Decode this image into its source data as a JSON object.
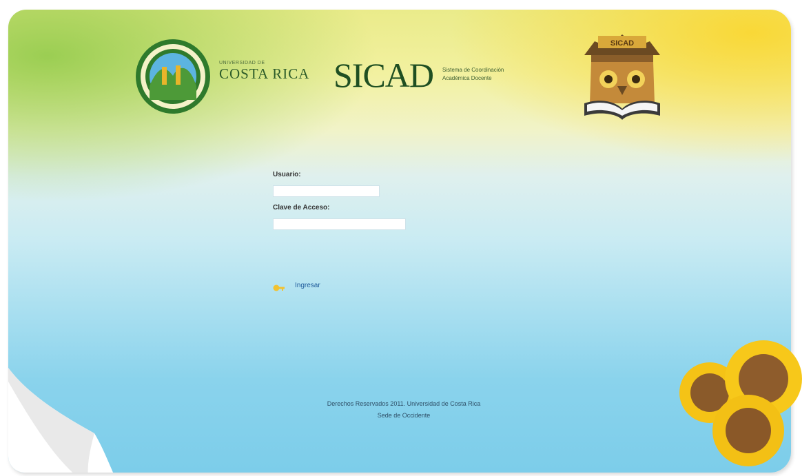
{
  "header": {
    "ucr_top_text": "UNIVERSIDAD DE",
    "ucr_name": "COSTA RICA",
    "system_name": "SICAD",
    "system_subtitle_line1": "Sistema de Coordinación",
    "system_subtitle_line2": "Académica Docente",
    "emblem_label": "SICAD"
  },
  "login": {
    "user_label": "Usuario:",
    "user_value": "",
    "password_label": "Clave de Acceso:",
    "password_value": "",
    "login_link": "Ingresar",
    "login_icon": "key-icon"
  },
  "footer": {
    "line1": "Derechos Reservados 2011. Universidad de Costa Rica",
    "line2": "Sede de Occidente"
  },
  "colors": {
    "top_left": "#8cc846",
    "top_right": "#fad732",
    "bottom": "#7ccdea",
    "link": "#1d5a9a"
  }
}
